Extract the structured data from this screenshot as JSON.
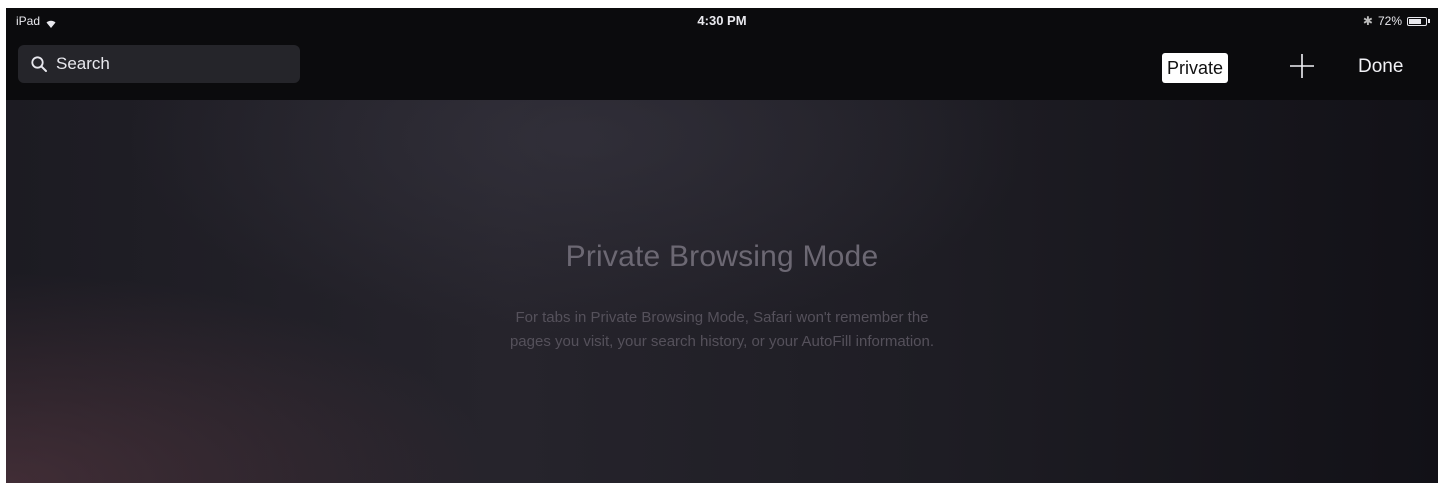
{
  "status_bar": {
    "device": "iPad",
    "time": "4:30 PM",
    "battery_percent": "72%",
    "battery_level": 0.72,
    "icons": [
      "wifi-icon",
      "bluetooth-icon",
      "battery-icon"
    ]
  },
  "toolbar": {
    "search_placeholder": "Search",
    "private_label": "Private",
    "add_tab_icon": "plus-icon",
    "done_label": "Done"
  },
  "main": {
    "title": "Private Browsing Mode",
    "message_line1": "For tabs in Private Browsing Mode, Safari won't remember the",
    "message_line2": "pages you visit, your search history, or your AutoFill information."
  },
  "colors": {
    "toolbar_bg": "#0b0b0d",
    "search_bg": "#25252a",
    "private_bg": "#ffffff",
    "title_text": "#6c6873"
  }
}
